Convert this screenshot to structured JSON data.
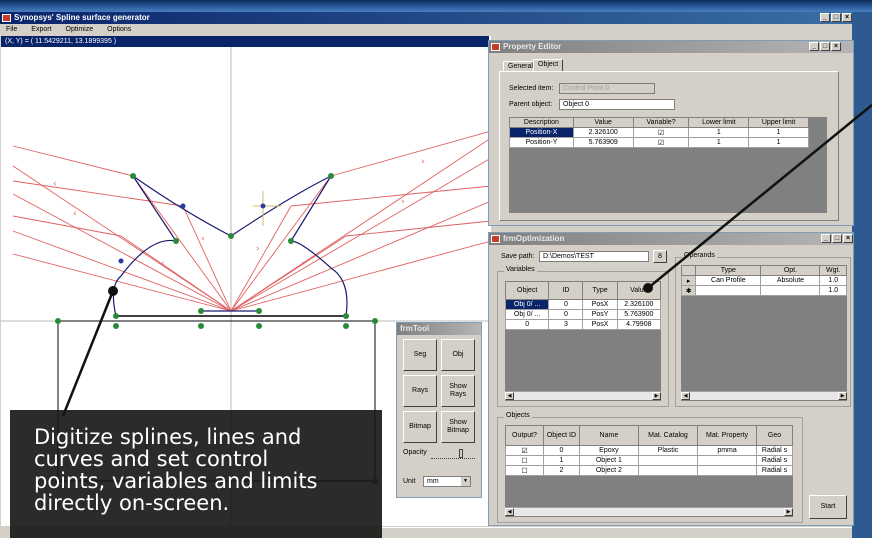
{
  "main_window": {
    "title": "Synopsys' Spline surface generator",
    "menu": [
      "File",
      "Export",
      "Optimize",
      "Options"
    ],
    "coord_readout": "(X, Y) = ( 11.5429211, 13.1899395 )",
    "controls": [
      "_",
      "□",
      "×"
    ]
  },
  "property_editor": {
    "title": "Property Editor",
    "tabs": [
      "General",
      "Object"
    ],
    "selected_item_label": "Selected item:",
    "selected_item_value": "Control Point 0",
    "parent_object_label": "Parent object:",
    "parent_object_value": "Object 0",
    "columns": [
      "Description",
      "Value",
      "Variable?",
      "Lower limit",
      "Upper limit"
    ],
    "rows": [
      {
        "description": "Position-X",
        "value": "2.326100",
        "variable": "☑",
        "lower": "1",
        "upper": "1"
      },
      {
        "description": "Position-Y",
        "value": "5.763909",
        "variable": "☑",
        "lower": "1",
        "upper": "1"
      }
    ]
  },
  "optimization": {
    "title": "frmOptimization",
    "save_path_label": "Save path:",
    "save_path_value": "D:\\Demos\\TEST",
    "browse_label": "8",
    "variables_group": "Variables",
    "var_columns": [
      "Object",
      "ID",
      "Type",
      "Value"
    ],
    "var_rows": [
      {
        "object": "Obj 0/ ...",
        "id": "0",
        "type": "PosX",
        "value": "2.326100"
      },
      {
        "object": "Obj 0/ ...",
        "id": "0",
        "type": "PosY",
        "value": "5.763900"
      },
      {
        "object": "0",
        "id": "3",
        "type": "PosX",
        "value": "4.79908"
      }
    ],
    "operands_group": "Operands",
    "op_columns": [
      "Type",
      "Opt.",
      "Wgt."
    ],
    "op_rows": [
      {
        "marker": "▸",
        "type": "Can Profile",
        "opt": "Absolute",
        "wgt": "1.0"
      },
      {
        "marker": "✱",
        "type": "",
        "opt": "",
        "wgt": "1.0"
      }
    ],
    "objects_group": "Objects",
    "obj_columns": [
      "Output?",
      "Object ID",
      "Name",
      "Mat. Catalog",
      "Mat. Property",
      "Geo"
    ],
    "obj_rows": [
      {
        "output": "☑",
        "id": "0",
        "name": "Epoxy",
        "catalog": "Plastic",
        "property": "pmma",
        "geo": "Radial s"
      },
      {
        "output": "☐",
        "id": "1",
        "name": "Object 1",
        "catalog": "",
        "property": "",
        "geo": "Radial s"
      },
      {
        "output": "☐",
        "id": "2",
        "name": "Object 2",
        "catalog": "",
        "property": "",
        "geo": "Radial s"
      }
    ],
    "start_label": "Start"
  },
  "tools": {
    "title": "frmTool",
    "buttons": [
      "Seg",
      "Obj",
      "Rays",
      "Show Rays",
      "Bitmap",
      "Show Bitmap"
    ],
    "opacity_label": "Opacity",
    "unit_label": "Unit",
    "unit_value": "mm",
    "opacity": 0.7
  },
  "caption": {
    "lines": [
      "Digitize splines, lines and",
      "curves and set control",
      "points, variables and limits",
      "directly on-screen."
    ]
  },
  "colors": {
    "ray": "#e06060",
    "spline": "#1a1a70",
    "control_point": "#2a8a3a",
    "control_point_blue": "#2a3aa0"
  }
}
